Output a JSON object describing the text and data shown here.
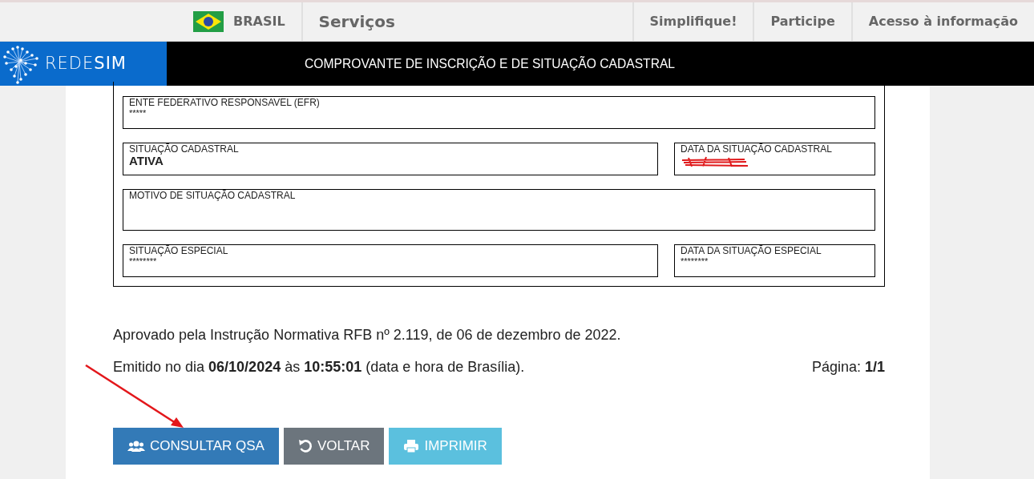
{
  "gov_bar": {
    "country": "BRASIL",
    "links": [
      "Serviços"
    ],
    "right_links": [
      "Simplifique!",
      "Participe",
      "Acesso à informação"
    ]
  },
  "header": {
    "logo": "REDE**SIM**",
    "title": "COMPROVANTE DE INSCRIÇÃO E DE SITUAÇÃO CADASTRAL"
  },
  "form_rows": [
    [
      {
        "label": "ENTE FEDERATIVO RESPONSAVEL (EFR)",
        "value": "*****",
        "bold": false
      }
    ],
    [
      {
        "label": "SITUAÇÃO CADASTRAL",
        "value": "ATIVA",
        "bold": true
      },
      {
        "label": "DATA DA SITUAÇÃO CADASTRAL",
        "redacted": true
      }
    ],
    [
      {
        "label": "MOTIVO DE SITUAÇÃO CADASTRAL",
        "tall": true
      }
    ],
    [
      {
        "label": "SITUAÇÃO ESPECIAL",
        "value": "********",
        "bold": false
      },
      {
        "label": "DATA DA SITUAÇÃO ESPECIAL",
        "value": "********",
        "bold": false
      }
    ]
  ],
  "approval_note": "Aprovado pela Instrução Normativa RFB nº 2.119, de 06 de dezembro de 2022.",
  "issued_note": "Emitido no dia **06/10/2024** às **10:55:01** (data e hora de Brasília).",
  "page_note": "Página: **1/1**",
  "buttons": [
    {
      "label": "CONSULTAR QSA",
      "kind": "primary"
    },
    {
      "label": "VOLTAR",
      "kind": "secondary"
    },
    {
      "label": "IMPRIMIR",
      "kind": "info"
    }
  ],
  "annotation": {
    "kind": "arrow"
  }
}
